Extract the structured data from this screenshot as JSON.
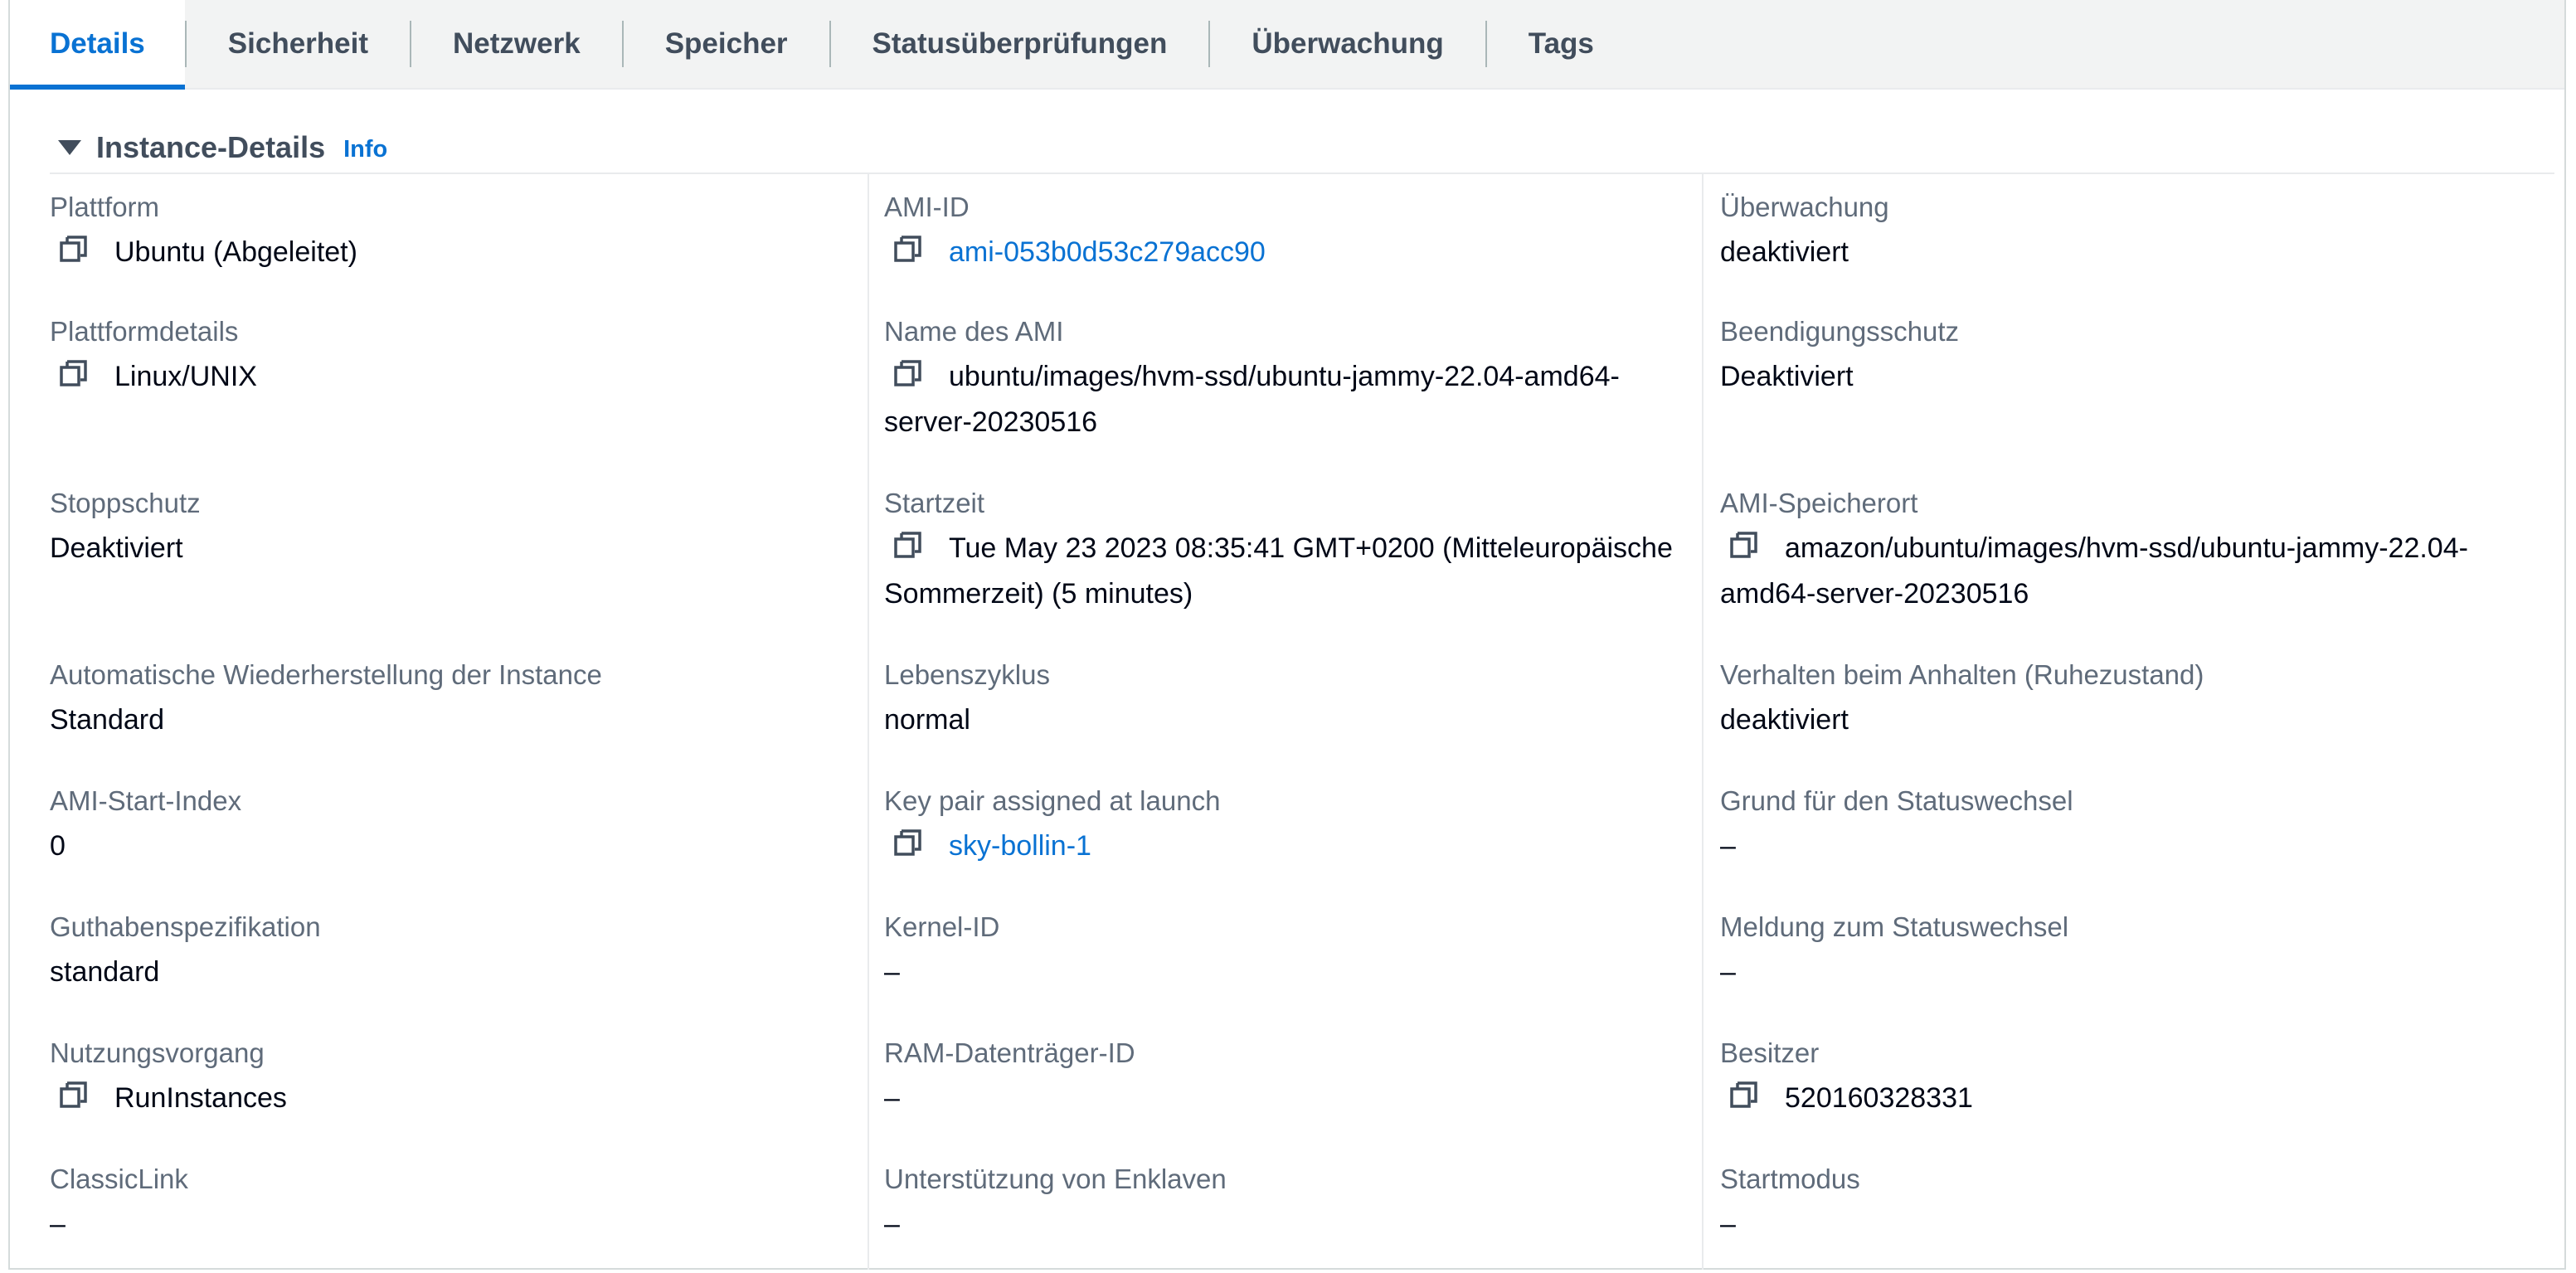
{
  "tabs": [
    {
      "label": "Details",
      "active": true
    },
    {
      "label": "Sicherheit",
      "active": false
    },
    {
      "label": "Netzwerk",
      "active": false
    },
    {
      "label": "Speicher",
      "active": false
    },
    {
      "label": "Statusüberprüfungen",
      "active": false
    },
    {
      "label": "Überwachung",
      "active": false
    },
    {
      "label": "Tags",
      "active": false
    }
  ],
  "section": {
    "title": "Instance-Details",
    "info": "Info"
  },
  "columns": [
    [
      {
        "label": "Plattform",
        "value": "Ubuntu (Abgeleitet)",
        "copy": true
      },
      {
        "label": "Plattformdetails",
        "value": "Linux/UNIX",
        "copy": true
      },
      {
        "label": "Stoppschutz",
        "value": "Deaktiviert"
      },
      {
        "label": "Automatische Wiederherstellung der Instance",
        "value": "Standard"
      },
      {
        "label": "AMI-Start-Index",
        "value": "0"
      },
      {
        "label": "Guthabenspezifikation",
        "value": "standard"
      },
      {
        "label": "Nutzungsvorgang",
        "value": "RunInstances",
        "copy": true
      },
      {
        "label": "ClassicLink",
        "value": "–"
      }
    ],
    [
      {
        "label": "AMI-ID",
        "value": "ami-053b0d53c279acc90",
        "copy": true,
        "link": true
      },
      {
        "label": "Name des AMI",
        "value": "ubuntu/images/hvm-ssd/ubuntu-jammy-22.04-amd64-server-20230516",
        "copy": true
      },
      {
        "label": "Startzeit",
        "value": "Tue May 23 2023 08:35:41 GMT+0200 (Mitteleuropäische Sommerzeit) (5 minutes)",
        "copy": true
      },
      {
        "label": "Lebenszyklus",
        "value": "normal"
      },
      {
        "label": "Key pair assigned at launch",
        "value": "sky-bollin-1",
        "copy": true,
        "link": true
      },
      {
        "label": "Kernel-ID",
        "value": "–"
      },
      {
        "label": "RAM-Datenträger-ID",
        "value": "–"
      },
      {
        "label": "Unterstützung von Enklaven",
        "value": "–"
      }
    ],
    [
      {
        "label": "Überwachung",
        "value": "deaktiviert"
      },
      {
        "label": "Beendigungsschutz",
        "value": "Deaktiviert"
      },
      {
        "label": "AMI-Speicherort",
        "value": "amazon/ubuntu/images/hvm-ssd/ubuntu-jammy-22.04-amd64-server-20230516",
        "copy": true
      },
      {
        "label": "Verhalten beim Anhalten (Ruhezustand)",
        "value": "deaktiviert"
      },
      {
        "label": "Grund für den Statuswechsel",
        "value": "–"
      },
      {
        "label": "Meldung zum Statuswechsel",
        "value": "–"
      },
      {
        "label": "Besitzer",
        "value": "520160328331",
        "copy": true
      },
      {
        "label": "Startmodus",
        "value": "–"
      }
    ]
  ],
  "colors": {
    "accent": "#0972d3",
    "label": "#5f6b7a",
    "text": "#000716",
    "tab_text": "#414d5c"
  }
}
